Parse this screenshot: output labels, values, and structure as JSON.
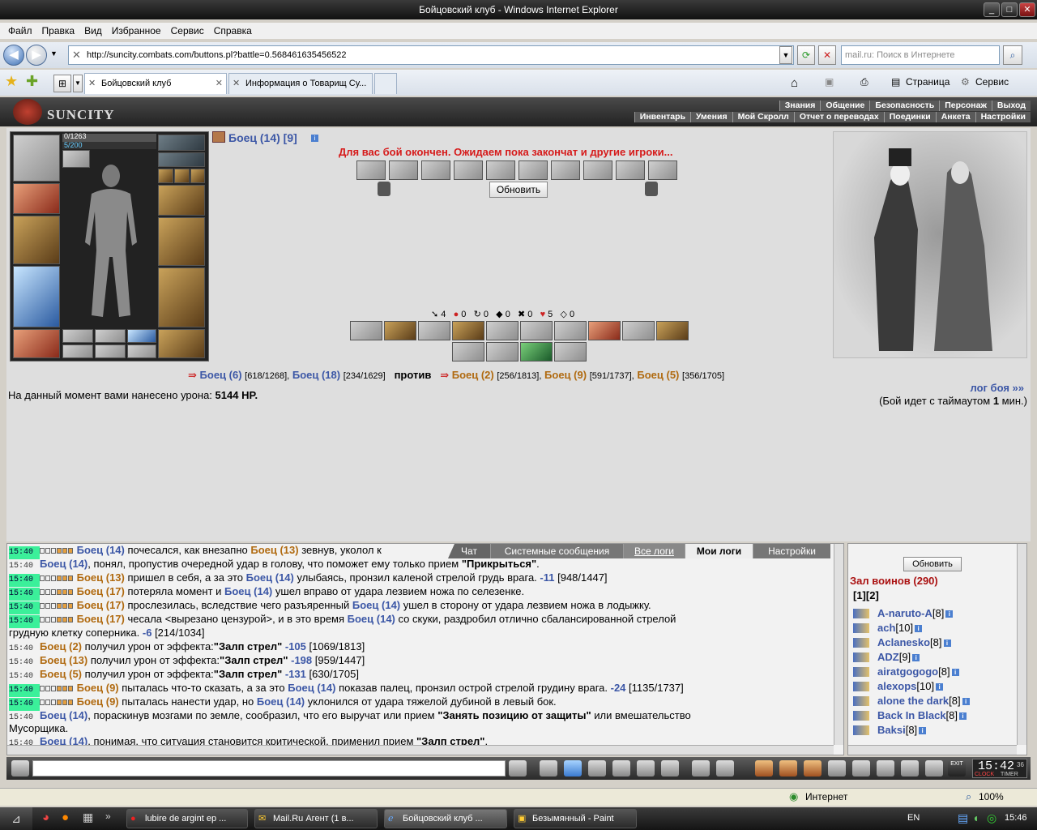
{
  "window": {
    "title": "Бойцовский клуб - Windows Internet Explorer",
    "min": "_",
    "max": "□",
    "close": "✕"
  },
  "menu": [
    "Файл",
    "Правка",
    "Вид",
    "Избранное",
    "Сервис",
    "Справка"
  ],
  "address": {
    "url": "http://suncity.combats.com/buttons.pl?battle=0.568461635456522"
  },
  "search": {
    "placeholder": "mail.ru: Поиск в Интернете"
  },
  "tabs": [
    {
      "label": "Бойцовский клуб"
    },
    {
      "label": "Информация о Товарищ Су..."
    }
  ],
  "commandbar": {
    "page": "Страница",
    "tools": "Сервис"
  },
  "game": {
    "logo": "SUNCITY",
    "nav_top": [
      "Знания",
      "Общение",
      "Безопасность",
      "Персонаж",
      "Выход"
    ],
    "nav_bottom": [
      "Инвентарь",
      "Умения",
      "Мой Скролл",
      "Отчет о переводах",
      "Поединки",
      "Анкета",
      "Настройки"
    ],
    "hp": "0/1263",
    "mana": "5/200",
    "player_name": "Боец (14) [9]",
    "battle_message": "Для вас бой окончен. Ожидаем пока закончат и другие игроки...",
    "refresh_button": "Обновить",
    "stats": [
      "4",
      "0",
      "0",
      "0",
      "0",
      "5",
      "0"
    ],
    "team1": [
      {
        "name": "Боец (6)",
        "hp": "[618/1268],"
      },
      {
        "name": "Боец (18)",
        "hp": "[234/1629]"
      }
    ],
    "versus": "против",
    "team2": [
      {
        "name": "Боец (2)",
        "hp": "[256/1813],"
      },
      {
        "name": "Боец (9)",
        "hp": "[591/1737],"
      },
      {
        "name": "Боец (5)",
        "hp": "[356/1705]"
      }
    ],
    "damage_label": "На данный момент вами нанесено урона:",
    "damage_value": "5144 HP.",
    "log_link": "лог боя »»",
    "timeout_pre": "(Бой идет с таймаутом",
    "timeout_val": "1",
    "timeout_post": "мин.)"
  },
  "logtabs": [
    "Чат",
    "Системные сообщения",
    "Все логи",
    "Мои логи",
    "Настройки"
  ],
  "log": [
    {
      "t": "15:40",
      "g": true,
      "parts": [
        [
          "b",
          "Боец (14)"
        ],
        [
          "n",
          " почесался, как внезапно "
        ],
        [
          "o",
          "Боец (13)"
        ],
        [
          "n",
          " зевнув, уколол к"
        ]
      ]
    },
    {
      "t": "15:40",
      "g": false,
      "parts": [
        [
          "b",
          "Боец (14)"
        ],
        [
          "n",
          ", понял, пропустив очередной удар в голову, что поможет ему только прием "
        ],
        [
          "k",
          "\"Прикрыться\""
        ],
        [
          "n",
          "."
        ]
      ]
    },
    {
      "t": "15:40",
      "g": true,
      "parts": [
        [
          "o",
          "Боец (13)"
        ],
        [
          "n",
          " пришел в себя, а за это "
        ],
        [
          "b",
          "Боец (14)"
        ],
        [
          "n",
          " улыбаясь, пронзил каленой стрелой грудь врага. "
        ],
        [
          "d",
          "-11"
        ],
        [
          "n",
          " [948/1447]"
        ]
      ]
    },
    {
      "t": "15:40",
      "g": true,
      "parts": [
        [
          "o",
          "Боец (17)"
        ],
        [
          "n",
          " потеряла момент и "
        ],
        [
          "b",
          "Боец (14)"
        ],
        [
          "n",
          " ушел вправо от удара лезвием ножа по селезенке."
        ]
      ]
    },
    {
      "t": "15:40",
      "g": true,
      "parts": [
        [
          "o",
          "Боец (17)"
        ],
        [
          "n",
          " прослезилась, вследствие чего разъяренный "
        ],
        [
          "b",
          "Боец (14)"
        ],
        [
          "n",
          " ушел в сторону от удара лезвием ножа в лодыжку."
        ]
      ]
    },
    {
      "t": "15:40",
      "g": true,
      "parts": [
        [
          "o",
          "Боец (17)"
        ],
        [
          "n",
          " чесала <вырезано цензурой>, и в это время "
        ],
        [
          "b",
          "Боец (14)"
        ],
        [
          "n",
          " со скуки, раздробил отлично сбалансированной стрелой"
        ]
      ]
    },
    {
      "t": "",
      "g": false,
      "parts": [
        [
          "n",
          "грудную клетку соперника. "
        ],
        [
          "d",
          "-6"
        ],
        [
          "n",
          " [214/1034]"
        ]
      ]
    },
    {
      "t": "15:40",
      "g": false,
      "parts": [
        [
          "o",
          "Боец (2)"
        ],
        [
          "n",
          " получил урон от эффекта:"
        ],
        [
          "k",
          "\"Залп стрел\""
        ],
        [
          "n",
          " "
        ],
        [
          "d",
          "-105"
        ],
        [
          "n",
          " [1069/1813]"
        ]
      ]
    },
    {
      "t": "15:40",
      "g": false,
      "parts": [
        [
          "o",
          "Боец (13)"
        ],
        [
          "n",
          " получил урон от эффекта:"
        ],
        [
          "k",
          "\"Залп стрел\""
        ],
        [
          "n",
          " "
        ],
        [
          "d",
          "-198"
        ],
        [
          "n",
          " [959/1447]"
        ]
      ]
    },
    {
      "t": "15:40",
      "g": false,
      "parts": [
        [
          "o",
          "Боец (5)"
        ],
        [
          "n",
          " получил урон от эффекта:"
        ],
        [
          "k",
          "\"Залп стрел\""
        ],
        [
          "n",
          " "
        ],
        [
          "d",
          "-131"
        ],
        [
          "n",
          " [630/1705]"
        ]
      ]
    },
    {
      "t": "15:40",
      "g": true,
      "parts": [
        [
          "o",
          "Боец (9)"
        ],
        [
          "n",
          " пыталась что-то сказать, а за это "
        ],
        [
          "b",
          "Боец (14)"
        ],
        [
          "n",
          " показав палец, пронзил острой стрелой грудину врага. "
        ],
        [
          "d",
          "-24"
        ],
        [
          "n",
          " [1135/1737]"
        ]
      ]
    },
    {
      "t": "15:40",
      "g": true,
      "parts": [
        [
          "o",
          "Боец (9)"
        ],
        [
          "n",
          " пыталась нанести удар, но "
        ],
        [
          "b",
          "Боец (14)"
        ],
        [
          "n",
          " уклонился от удара тяжелой дубиной в левый бок."
        ]
      ]
    },
    {
      "t": "15:40",
      "g": false,
      "parts": [
        [
          "b",
          "Боец (14)"
        ],
        [
          "n",
          ", пораскинув мозгами по земле, сообразил, что его выручат или прием "
        ],
        [
          "k",
          "\"Занять позицию от защиты\""
        ],
        [
          "n",
          " или вмешательство"
        ]
      ]
    },
    {
      "t": "",
      "g": false,
      "parts": [
        [
          "n",
          "Мусорщика."
        ]
      ]
    },
    {
      "t": "15:40",
      "g": false,
      "parts": [
        [
          "b",
          "Боец (14)"
        ],
        [
          "n",
          ", понимая, что ситуация становится критической, применил прием "
        ],
        [
          "k",
          "\"Залп стрел\""
        ],
        [
          "n",
          "."
        ]
      ]
    }
  ],
  "room": {
    "refresh": "Обновить",
    "title": "Зал воинов (290)",
    "pages": "[1][2]",
    "users": [
      {
        "name": "A-naruto-A",
        "lvl": "[8]"
      },
      {
        "name": "ach",
        "lvl": "[10]"
      },
      {
        "name": "Aclanesko",
        "lvl": "[8]"
      },
      {
        "name": "ADZ",
        "lvl": "[9]"
      },
      {
        "name": "airatgogogo",
        "lvl": "[8]"
      },
      {
        "name": "alexops",
        "lvl": "[10]"
      },
      {
        "name": "alone the dark",
        "lvl": "[8]"
      },
      {
        "name": "Back In Black",
        "lvl": "[8]"
      },
      {
        "name": "Baksi",
        "lvl": "[8]"
      }
    ]
  },
  "clock": {
    "time": "15:42",
    "sec": "36",
    "clock_label": "CLOCK",
    "timer_label": "TIMER",
    "exit": "EXIT"
  },
  "status": {
    "zone": "Интернет",
    "zoom": "100%"
  },
  "taskbar": {
    "items": [
      "lubire de argint ep ...",
      "Mail.Ru Агент (1 в...",
      "Бойцовский клуб ...",
      "Безымянный - Paint"
    ],
    "lang": "EN",
    "time": "15:46"
  }
}
